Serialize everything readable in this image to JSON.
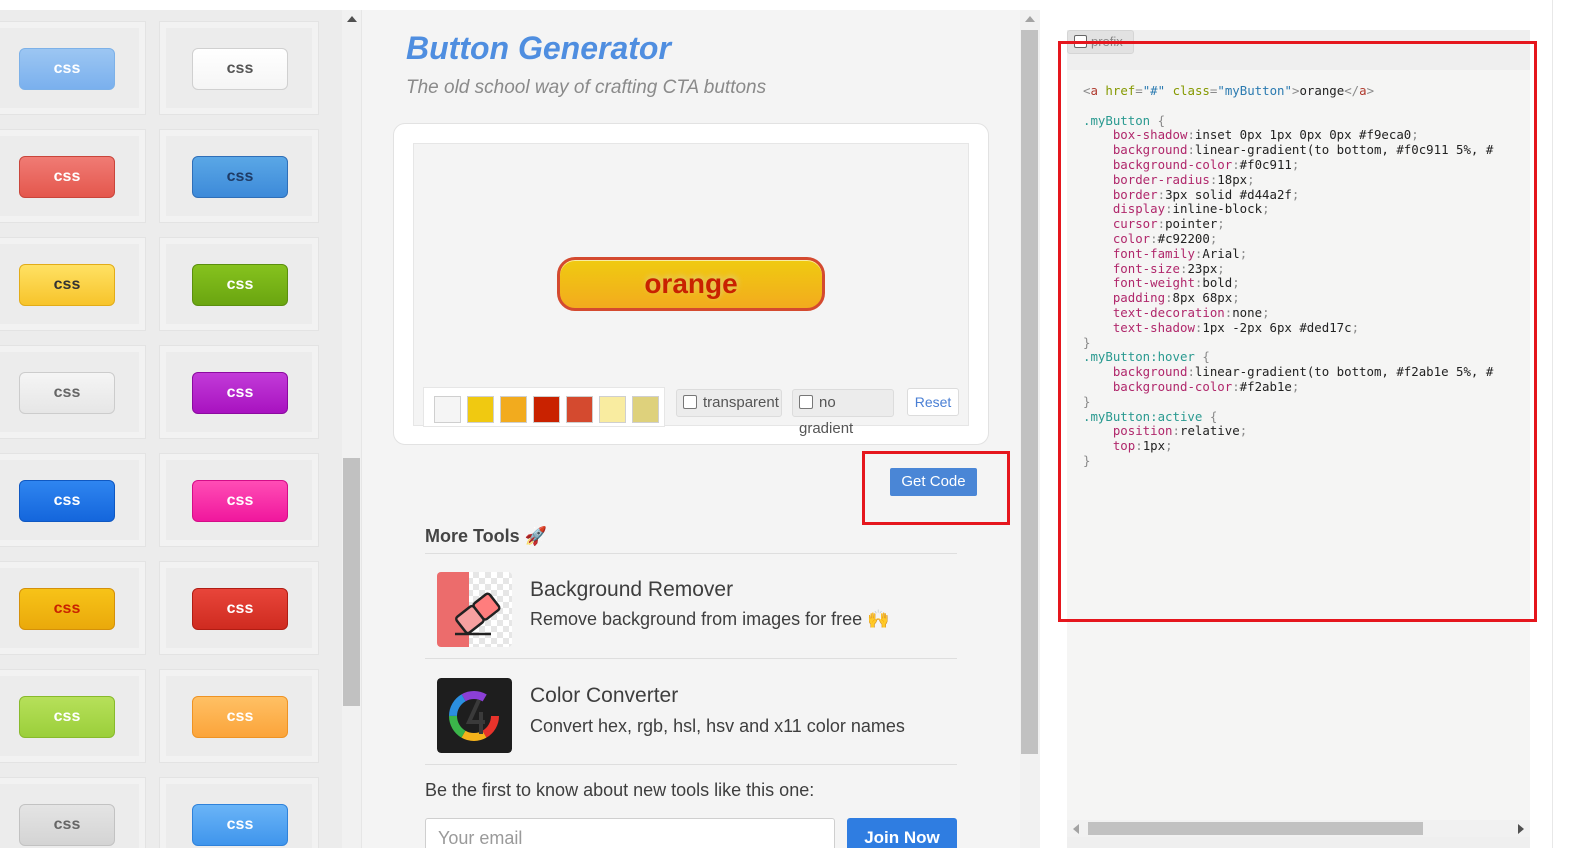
{
  "gallery": {
    "buttons": [
      {
        "label": "css",
        "bg": "#9cc6f2",
        "bg2": "#7ab0ee",
        "border": "#7db1e8",
        "color": "#ffffff"
      },
      {
        "label": "css",
        "bg": "#ffffff",
        "bg2": "#f5f5f5",
        "border": "#d0d0d0",
        "color": "#555555"
      },
      {
        "label": "css",
        "bg": "#f07b74",
        "bg2": "#e4574d",
        "border": "#c9453b",
        "color": "#ffffff"
      },
      {
        "label": "css",
        "bg": "#5aa7e6",
        "bg2": "#3d8ad9",
        "border": "#2f6fb8",
        "color": "#1e3b66"
      },
      {
        "label": "css",
        "bg": "#ffe163",
        "bg2": "#f7c42b",
        "border": "#e2ac18",
        "color": "#333333"
      },
      {
        "label": "css",
        "bg": "#86c21e",
        "bg2": "#6aa510",
        "border": "#5b8f0e",
        "color": "#ffffff"
      },
      {
        "label": "css",
        "bg": "#f5f5f5",
        "bg2": "#e6e6e6",
        "border": "#cccccc",
        "color": "#666666"
      },
      {
        "label": "css",
        "bg": "#c23bd8",
        "bg2": "#a812c0",
        "border": "#8c0aa0",
        "color": "#ffffff"
      },
      {
        "label": "css",
        "bg": "#2f85f0",
        "bg2": "#1466dc",
        "border": "#0f58c2",
        "color": "#ffffff"
      },
      {
        "label": "css",
        "bg": "#ff4db5",
        "bg2": "#f0179d",
        "border": "#d40d88",
        "color": "#ffffff"
      },
      {
        "label": "css",
        "bg": "#f7c318",
        "bg2": "#eaa90b",
        "border": "#d4900a",
        "color": "#c92200"
      },
      {
        "label": "css",
        "bg": "#e8453a",
        "bg2": "#cf2b20",
        "border": "#b01d14",
        "color": "#ffffff"
      },
      {
        "label": "css",
        "bg": "#b6e05a",
        "bg2": "#9bcf3a",
        "border": "#88ba2c",
        "color": "#ffffff"
      },
      {
        "label": "css",
        "bg": "#ffc064",
        "bg2": "#fba43a",
        "border": "#ee9324",
        "color": "#ffffff"
      },
      {
        "label": "css",
        "bg": "#e4e4e4",
        "bg2": "#d4d4d4",
        "border": "#c2c2c2",
        "color": "#666666"
      },
      {
        "label": "css",
        "bg": "#6ab4f7",
        "bg2": "#3f95ec",
        "border": "#2f82da",
        "color": "#ffffff"
      }
    ]
  },
  "header": {
    "title": "Button Generator",
    "subtitle": "The old school way of crafting CTA buttons"
  },
  "preview": {
    "button_label": "orange",
    "swatches": [
      "#f5f5f5",
      "#f0c911",
      "#f2ab1e",
      "#c92200",
      "#d44a2f",
      "#f9eca0",
      "#ded17c"
    ],
    "transparent_label": "transparent",
    "no_gradient_label": "no gradient",
    "reset_label": "Reset"
  },
  "get_code_label": "Get Code",
  "more_tools": {
    "heading": "More Tools 🚀",
    "tools": [
      {
        "title": "Background Remover",
        "desc": "Remove background from images for free 🙌",
        "icon": "eraser-icon"
      },
      {
        "title": "Color Converter",
        "desc": "Convert hex, rgb, hsl, hsv and x11 color names",
        "icon": "color-wheel-icon"
      }
    ]
  },
  "newsletter": {
    "text": "Be the first to know about new tools like this one:",
    "placeholder": "Your email",
    "join_label": "Join Now"
  },
  "code_panel": {
    "prefix_label": "prefix",
    "html_line": "<a href=\"#\" class=\"myButton\">orange</a>",
    "css_lines": [
      ".myButton {",
      "    box-shadow:inset 0px 1px 0px 0px #f9eca0;",
      "    background:linear-gradient(to bottom, #f0c911 5%, #",
      "    background-color:#f0c911;",
      "    border-radius:18px;",
      "    border:3px solid #d44a2f;",
      "    display:inline-block;",
      "    cursor:pointer;",
      "    color:#c92200;",
      "    font-family:Arial;",
      "    font-size:23px;",
      "    font-weight:bold;",
      "    padding:8px 68px;",
      "    text-decoration:none;",
      "    text-shadow:1px -2px 6px #ded17c;",
      "}",
      ".myButton:hover {",
      "    background:linear-gradient(to bottom, #f2ab1e 5%, #",
      "    background-color:#f2ab1e;",
      "}",
      ".myButton:active {",
      "    position:relative;",
      "    top:1px;",
      "}"
    ]
  },
  "colors": {
    "title_blue": "#4f8ee0",
    "highlight_red": "#e5161d",
    "get_code_blue": "#4a86d6"
  }
}
